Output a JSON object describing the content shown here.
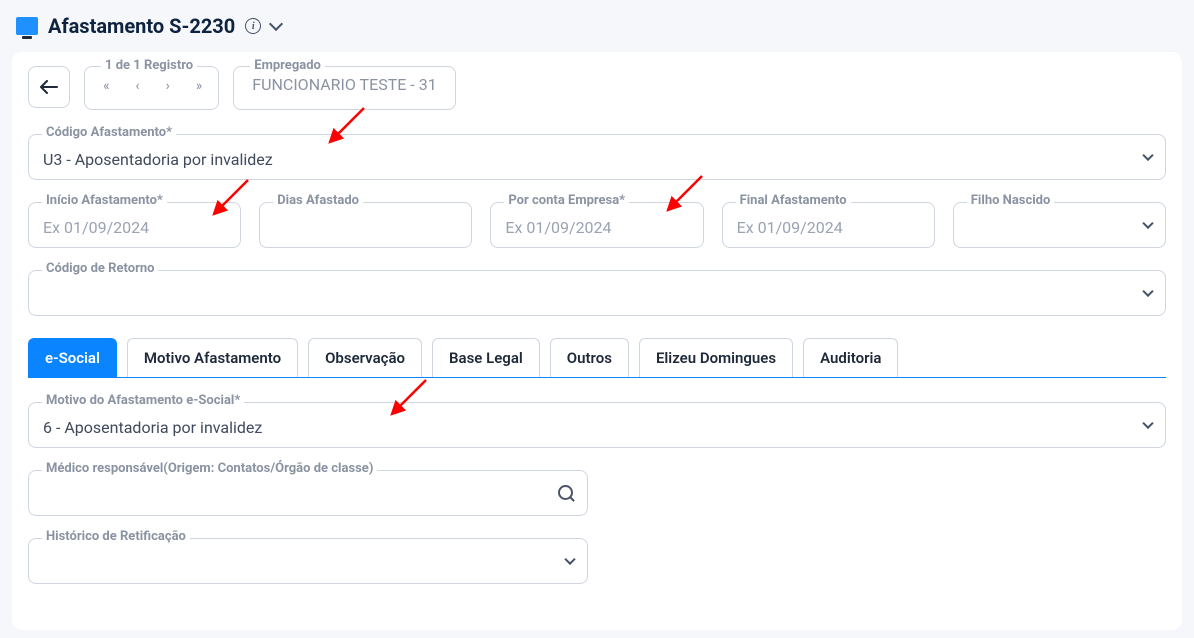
{
  "header": {
    "title": "Afastamento S-2230"
  },
  "pager": {
    "label": "1 de 1 Registro"
  },
  "empregado": {
    "label": "Empregado",
    "value": "FUNCIONARIO TESTE - 31"
  },
  "codigoAfastamento": {
    "label": "Código Afastamento*",
    "value": "U3 - Aposentadoria por invalidez"
  },
  "inicioAfastamento": {
    "label": "Início Afastamento*",
    "placeholder": "Ex 01/09/2024"
  },
  "diasAfastado": {
    "label": "Dias Afastado",
    "placeholder": ""
  },
  "porContaEmpresa": {
    "label": "Por conta Empresa*",
    "placeholder": "Ex 01/09/2024"
  },
  "finalAfastamento": {
    "label": "Final Afastamento",
    "placeholder": "Ex 01/09/2024"
  },
  "filhoNascido": {
    "label": "Filho Nascido",
    "placeholder": ""
  },
  "codigoRetorno": {
    "label": "Código de Retorno",
    "value": ""
  },
  "tabs": [
    "e-Social",
    "Motivo Afastamento",
    "Observação",
    "Base Legal",
    "Outros",
    "Elizeu Domingues",
    "Auditoria"
  ],
  "motivoEsocial": {
    "label": "Motivo do Afastamento e-Social*",
    "value": "6 - Aposentadoria por invalidez"
  },
  "medico": {
    "label": "Médico responsável(Origem: Contatos/Órgão de classe)",
    "value": ""
  },
  "historicoRetificacao": {
    "label": "Histórico de Retificação",
    "value": ""
  }
}
